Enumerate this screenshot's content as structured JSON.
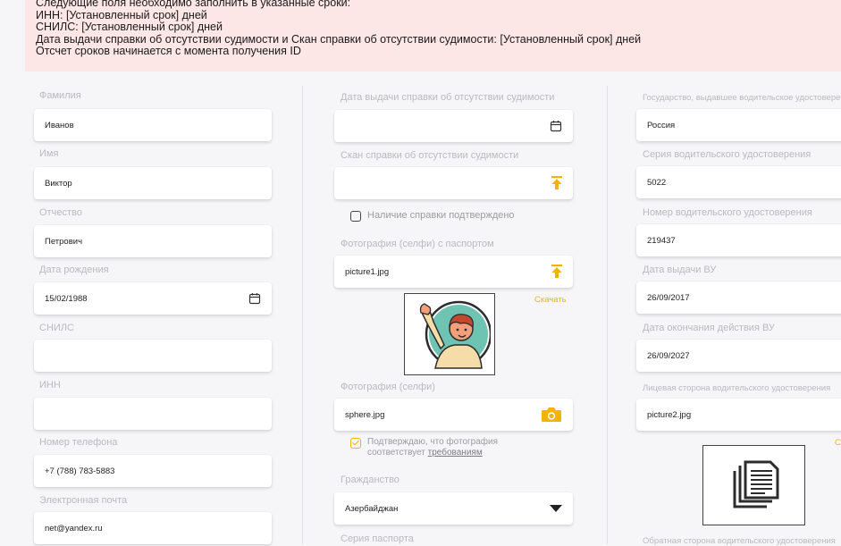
{
  "alert": {
    "lines": [
      "Следующие поля необходимо заполнить в указанные сроки:",
      "ИНН: [Установленный срок] дней",
      "СНИЛС: [Установленный срок] дней",
      "Дата выдачи справки об отсутствии судимости и Скан справки об отсутствии судимости: [Установленный срок] дней",
      "Отсчет сроков начинается с момента получения ID"
    ]
  },
  "col1": {
    "lastname_label": "Фамилия",
    "lastname": "Иванов",
    "firstname_label": "Имя",
    "firstname": "Виктор",
    "patronymic_label": "Отчество",
    "patronymic": "Петрович",
    "birthdate_label": "Дата рождения",
    "birthdate": "15/02/1988",
    "snils_label": "СНИЛС",
    "snils": "",
    "inn_label": "ИНН",
    "inn": "",
    "phone_label": "Номер телефона",
    "phone": "+7 (788) 783-5883",
    "email_label": "Электронная почта",
    "email": "net@yandex.ru"
  },
  "col2": {
    "cert_date_label": "Дата выдачи справки об отсутствии судимости",
    "cert_date": "",
    "cert_scan_label": "Скан справки об отсутствии судимости",
    "cert_scan": "",
    "cert_confirmed_label": "Наличие справки подтверждено",
    "selfie_passport_label": "Фотография (селфи) с паспортом",
    "selfie_passport_file": "picture1.jpg",
    "download_label": "Скачать",
    "selfie_label": "Фотография (селфи)",
    "selfie_file": "sphere.jpg",
    "confirm_text_1": "Подтверждаю, что фотография",
    "confirm_text_2": "соответствует ",
    "confirm_link": "требованиям",
    "citizenship_label": "Гражданство",
    "citizenship": "Азербайджан",
    "passport_series_label": "Серия паспорта"
  },
  "col3": {
    "dl_country_label": "Государство, выдавшее водительское удостоверение",
    "dl_country": "Россия",
    "dl_series_label": "Серия водительского удостоверения",
    "dl_series": "5022",
    "dl_number_label": "Номер водительского удостоверения",
    "dl_number": "219437",
    "dl_issue_label": "Дата выдачи ВУ",
    "dl_issue": "26/09/2017",
    "dl_expiry_label": "Дата окончания действия ВУ",
    "dl_expiry": "26/09/2027",
    "dl_front_label": "Лицевая сторона водительского удостоверения",
    "dl_front_file": "picture2.jpg",
    "download_partial": "С",
    "dl_back_label": "Обратная сторона водительского удостоверения"
  },
  "colors": {
    "accent": "#f2b400",
    "alert_bg": "#fde6e6",
    "label": "#b9b9c0"
  }
}
